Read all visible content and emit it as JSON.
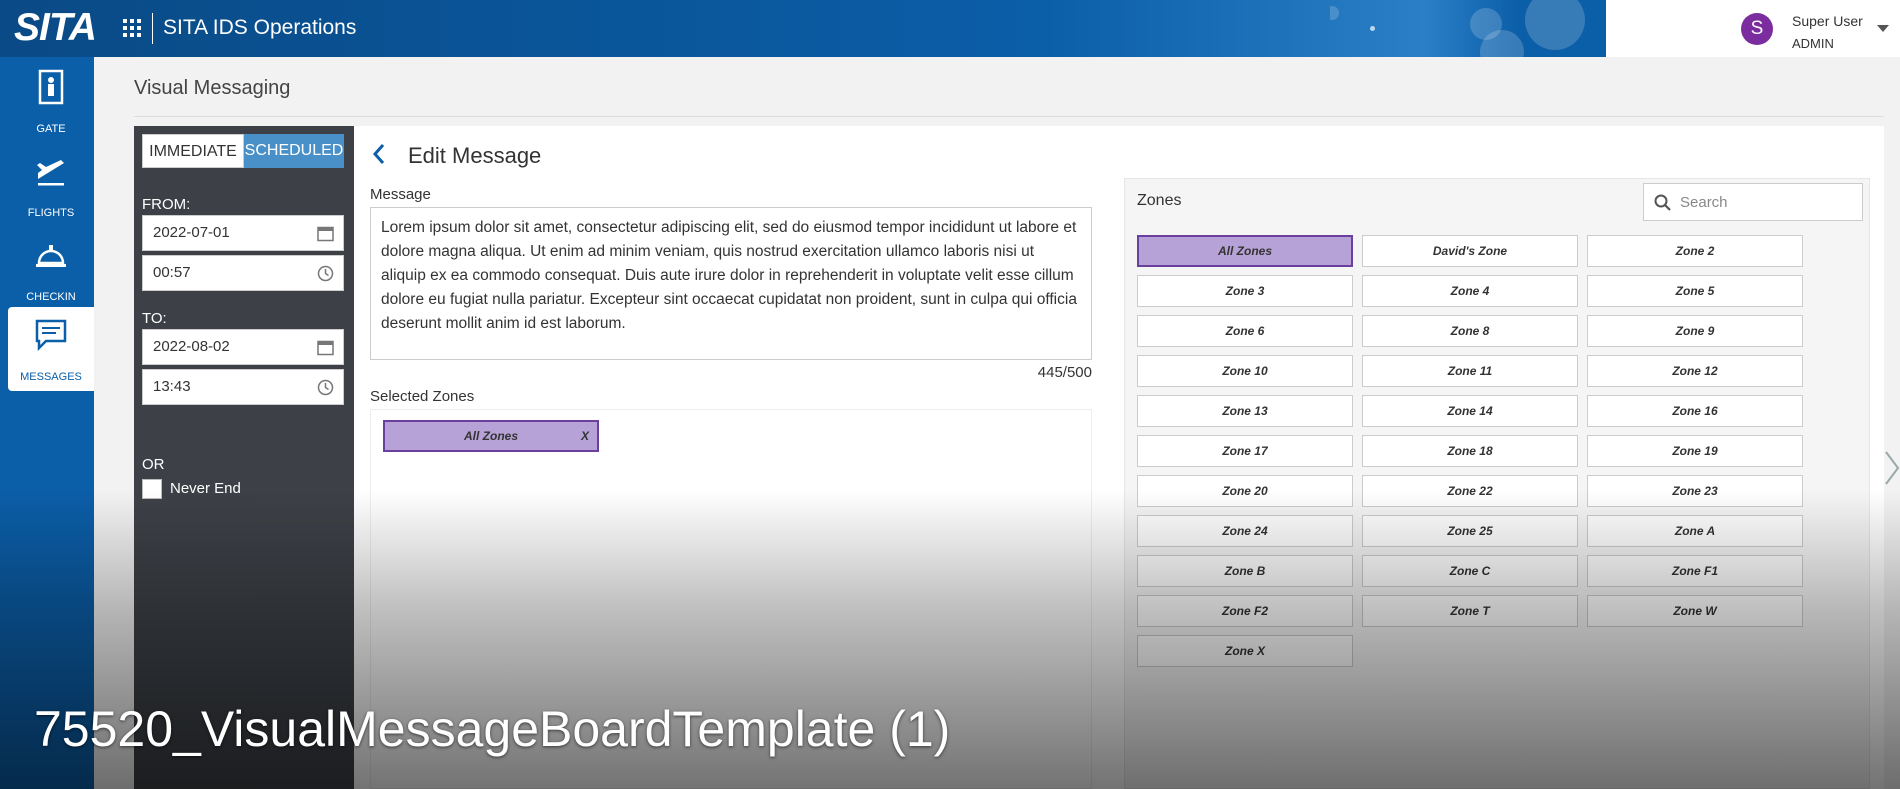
{
  "topbar": {
    "brand": "SITA",
    "app_title": "SITA IDS Operations"
  },
  "user": {
    "initial": "S",
    "name": "Super User",
    "role": "ADMIN"
  },
  "leftnav": {
    "items": [
      {
        "label": "GATE",
        "icon": "gate-icon"
      },
      {
        "label": "FLIGHTS",
        "icon": "airplane-icon"
      },
      {
        "label": "CHECKIN",
        "icon": "service-bell-icon"
      },
      {
        "label": "MESSAGES",
        "icon": "chat-icon",
        "active": true
      }
    ]
  },
  "page": {
    "title": "Visual Messaging"
  },
  "schedule": {
    "mode_immediate": "IMMEDIATE",
    "mode_scheduled": "SCHEDULED",
    "active_mode": "SCHEDULED",
    "from_label": "FROM:",
    "from_date": "2022-07-01",
    "from_time": "00:57",
    "to_label": "TO:",
    "to_date": "2022-08-02",
    "to_time": "13:43",
    "or_label": "OR",
    "never_end_label": "Never End",
    "never_end_checked": false
  },
  "editor": {
    "title": "Edit Message",
    "message_label": "Message",
    "message_text": "Lorem ipsum dolor sit amet, consectetur adipiscing elit, sed do eiusmod tempor incididunt ut labore et dolore magna aliqua. Ut enim ad minim veniam, quis nostrud exercitation ullamco laboris nisi ut aliquip ex ea commodo consequat. Duis aute irure dolor in reprehenderit in voluptate velit esse cillum dolore eu fugiat nulla pariatur. Excepteur sint occaecat cupidatat non proident, sunt in culpa qui officia deserunt mollit anim id est laborum.",
    "char_count": "445/500",
    "selected_zones_label": "Selected Zones",
    "selected_zones": [
      {
        "name": "All Zones",
        "remove": "X"
      }
    ]
  },
  "zones": {
    "label": "Zones",
    "search_placeholder": "Search",
    "selected_color": "#b6a2d6",
    "items": [
      "All Zones",
      "David's Zone",
      "Zone 2",
      "Zone 3",
      "Zone 4",
      "Zone 5",
      "Zone 6",
      "Zone 8",
      "Zone 9",
      "Zone 10",
      "Zone 11",
      "Zone 12",
      "Zone 13",
      "Zone 14",
      "Zone 16",
      "Zone 17",
      "Zone 18",
      "Zone 19",
      "Zone 20",
      "Zone 22",
      "Zone 23",
      "Zone 24",
      "Zone 25",
      "Zone A",
      "Zone B",
      "Zone C",
      "Zone F1",
      "Zone F2",
      "Zone T",
      "Zone W",
      "Zone X"
    ],
    "selected": [
      "All Zones"
    ]
  },
  "video": {
    "title": "75520_VisualMessageBoardTemplate (1)"
  }
}
